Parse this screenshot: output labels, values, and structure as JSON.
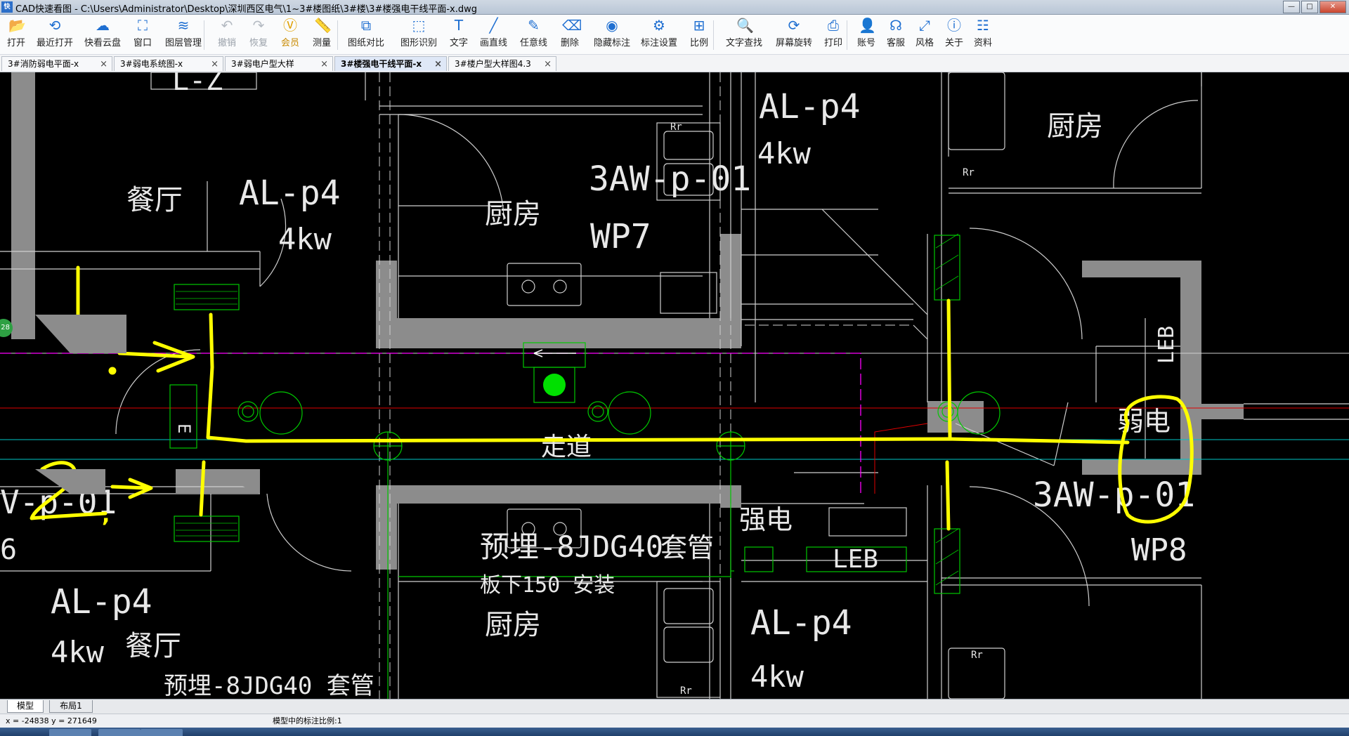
{
  "window": {
    "app_icon_text": "快",
    "title": "CAD快速看图 - C:\\Users\\Administrator\\Desktop\\深圳西区电气\\1~3#楼图纸\\3#楼\\3#楼强电干线平面-x.dwg",
    "minimize": "—",
    "maximize": "□",
    "close": "✕"
  },
  "toolbar": [
    {
      "label": "打开",
      "icon": "folder-open-icon",
      "glyph": "📂"
    },
    {
      "label": "最近打开",
      "icon": "history-icon",
      "glyph": "⟲"
    },
    {
      "label": "快看云盘",
      "icon": "cloud-icon",
      "glyph": "☁"
    },
    {
      "label": "窗口",
      "icon": "window-icon",
      "glyph": "⛶"
    },
    {
      "label": "图层管理",
      "icon": "layers-icon",
      "glyph": "≋"
    },
    {
      "label": "撤销",
      "icon": "undo-icon",
      "glyph": "↶"
    },
    {
      "label": "恢复",
      "icon": "redo-icon",
      "glyph": "↷"
    },
    {
      "label": "会员",
      "icon": "vip-icon",
      "glyph": "Ⓥ"
    },
    {
      "label": "测量",
      "icon": "ruler-icon",
      "glyph": "📏"
    },
    {
      "label": "图纸对比",
      "icon": "compare-icon",
      "glyph": "⧉"
    },
    {
      "label": "图形识别",
      "icon": "shape-recognize-icon",
      "glyph": "⬚"
    },
    {
      "label": "文字",
      "icon": "text-icon",
      "glyph": "T"
    },
    {
      "label": "画直线",
      "icon": "line-icon",
      "glyph": "╱"
    },
    {
      "label": "任意线",
      "icon": "pen-icon",
      "glyph": "✎"
    },
    {
      "label": "删除",
      "icon": "eraser-icon",
      "glyph": "⌫"
    },
    {
      "label": "隐藏标注",
      "icon": "hide-annotation-icon",
      "glyph": "◉"
    },
    {
      "label": "标注设置",
      "icon": "annotation-settings-icon",
      "glyph": "⚙"
    },
    {
      "label": "比例",
      "icon": "scale-icon",
      "glyph": "⊞"
    },
    {
      "label": "文字查找",
      "icon": "text-search-icon",
      "glyph": "🔍"
    },
    {
      "label": "屏幕旋转",
      "icon": "rotate-screen-icon",
      "glyph": "⟳"
    },
    {
      "label": "打印",
      "icon": "printer-icon",
      "glyph": "⎙"
    },
    {
      "label": "账号",
      "icon": "user-icon",
      "glyph": "👤"
    },
    {
      "label": "客服",
      "icon": "headset-icon",
      "glyph": "☊"
    },
    {
      "label": "风格",
      "icon": "style-icon",
      "glyph": "⤢"
    },
    {
      "label": "关于",
      "icon": "info-icon",
      "glyph": "ⓘ"
    },
    {
      "label": "资料",
      "icon": "documents-icon",
      "glyph": "☷"
    }
  ],
  "tabs": [
    {
      "label": "3#消防弱电平面-x",
      "active": false
    },
    {
      "label": "3#弱电系统图-x",
      "active": false
    },
    {
      "label": "3#弱电户型大样",
      "active": false
    },
    {
      "label": "3#楼强电干线平面-x",
      "active": true
    },
    {
      "label": "3#楼户型大样图4.3",
      "active": false
    }
  ],
  "tab_close": "×",
  "nav_badge": "28",
  "drawing_text": {
    "al_p4": "AL-p4",
    "kw4": "4kw",
    "dining": "餐厅",
    "kitchen": "厨房",
    "wp7": "WP7",
    "wp8": "WP8",
    "aw_p_01": "3AW-p-01",
    "corridor": "走道",
    "weak_elec": "弱电",
    "strong_elec": "强电",
    "leb": "LEB",
    "embed": "预埋-8JDG40",
    "sleeve": "套管",
    "install": "板下150 安装",
    "rr": "Rr",
    "e_box": "E",
    "aw_left": "V-p-01",
    "cut_z": "L-Z",
    "bottom_cut": "预埋-8JDG40    套管",
    "six": "6"
  },
  "annotations": {
    "one": "1",
    "two": "2",
    "comma": ","
  },
  "layout_tabs": [
    {
      "label": "模型",
      "active": true
    },
    {
      "label": "布局1",
      "active": false
    }
  ],
  "status": {
    "coords": "x = -24838 y = 271649",
    "scale": "模型中的标注比例:1"
  },
  "colors": {
    "canvas": "#000000",
    "wall": "#8c8c8c",
    "hatch": "#00c800",
    "markup": "#ffff00",
    "line_white": "#d9d9d9",
    "magenta": "#ff00ff",
    "red": "#e00000",
    "cyan": "#00c8c8"
  }
}
